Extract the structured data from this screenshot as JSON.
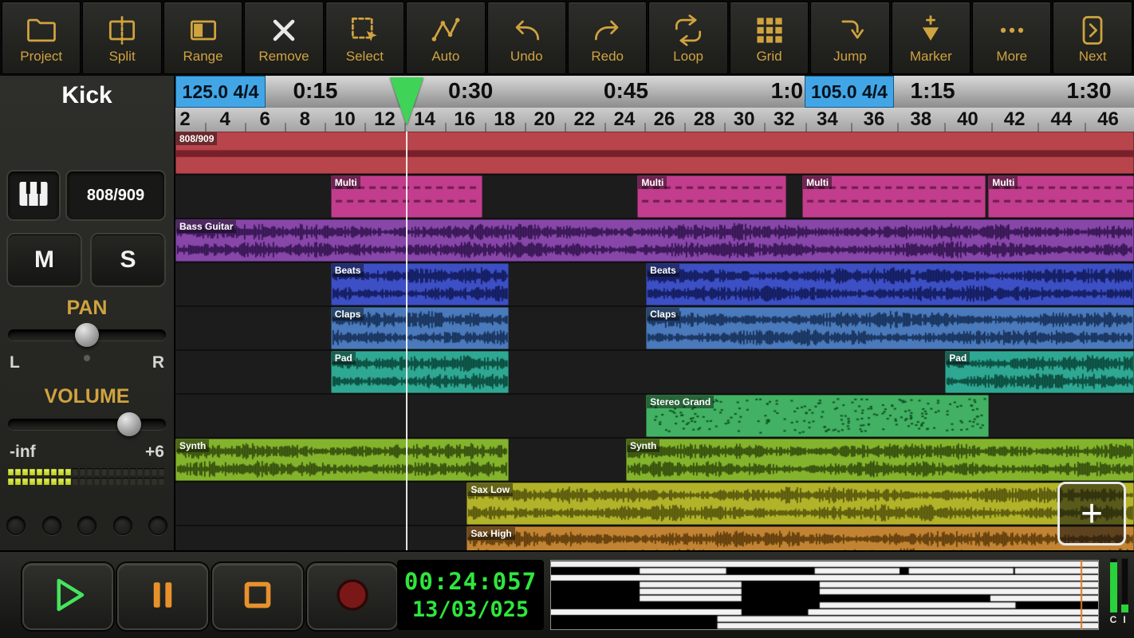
{
  "toolbar": {
    "items": [
      {
        "label": "Project",
        "icon": "folder"
      },
      {
        "label": "Split",
        "icon": "split"
      },
      {
        "label": "Range",
        "icon": "range"
      },
      {
        "label": "Remove",
        "icon": "remove"
      },
      {
        "label": "Select",
        "icon": "select"
      },
      {
        "label": "Auto",
        "icon": "auto"
      },
      {
        "label": "Undo",
        "icon": "undo"
      },
      {
        "label": "Redo",
        "icon": "redo"
      },
      {
        "label": "Loop",
        "icon": "loop"
      },
      {
        "label": "Grid",
        "icon": "grid"
      },
      {
        "label": "Jump",
        "icon": "jump"
      },
      {
        "label": "Marker",
        "icon": "marker"
      },
      {
        "label": "More",
        "icon": "more"
      },
      {
        "label": "Next",
        "icon": "next"
      }
    ],
    "accent_color": "#cfa33f"
  },
  "sidebar": {
    "track_name": "Kick",
    "instrument_label": "808/909",
    "mute": "M",
    "solo": "S",
    "pan": {
      "label": "PAN",
      "left": "L",
      "right": "R",
      "position_pct": 50
    },
    "volume": {
      "label": "VOLUME",
      "min": "-inf",
      "max": "+6",
      "position_pct": 77
    },
    "meter": {
      "rows": 2,
      "segments": 22,
      "lit": 9
    },
    "indicator_count": 5
  },
  "ruler": {
    "tempo_markers": [
      {
        "text": "125.0  4/4",
        "left_pct": 0,
        "width_pct": 9.4
      },
      {
        "text": "105.0  4/4",
        "left_pct": 65.6,
        "width_pct": 9.4
      }
    ],
    "times": [
      {
        "text": "0:15",
        "center_pct": 14.6
      },
      {
        "text": "0:30",
        "center_pct": 30.8
      },
      {
        "text": "0:45",
        "center_pct": 47.0
      },
      {
        "text": "1:0",
        "center_pct": 63.8
      },
      {
        "text": "1:15",
        "center_pct": 79.0
      },
      {
        "text": "1:30",
        "center_pct": 95.3
      }
    ],
    "bars": [
      {
        "n": "2",
        "c": 1.0
      },
      {
        "n": "4",
        "c": 5.17
      },
      {
        "n": "6",
        "c": 9.33
      },
      {
        "n": "8",
        "c": 13.5
      },
      {
        "n": "10",
        "c": 17.67
      },
      {
        "n": "12",
        "c": 21.83
      },
      {
        "n": "14",
        "c": 26.0
      },
      {
        "n": "16",
        "c": 30.17
      },
      {
        "n": "18",
        "c": 34.33
      },
      {
        "n": "20",
        "c": 38.5
      },
      {
        "n": "22",
        "c": 42.67
      },
      {
        "n": "24",
        "c": 46.83
      },
      {
        "n": "26",
        "c": 51.0
      },
      {
        "n": "28",
        "c": 55.17
      },
      {
        "n": "30",
        "c": 59.33
      },
      {
        "n": "32",
        "c": 63.5
      },
      {
        "n": "34",
        "c": 68.0
      },
      {
        "n": "36",
        "c": 72.88
      },
      {
        "n": "38",
        "c": 77.77
      },
      {
        "n": "40",
        "c": 82.65
      },
      {
        "n": "42",
        "c": 87.53
      },
      {
        "n": "44",
        "c": 92.42
      },
      {
        "n": "46",
        "c": 97.3
      }
    ]
  },
  "playhead": {
    "position_pct": 24.1,
    "color": "#3fd457"
  },
  "tracks": [
    {
      "name": "808/909",
      "color": "#b9454c",
      "accent": "#76202a",
      "style": "band",
      "clips": [
        {
          "start_pct": 0,
          "width_pct": 100
        }
      ]
    },
    {
      "name": "Multi",
      "color": "#c23d8d",
      "accent": "#6c1c4c",
      "style": "dash",
      "clips": [
        {
          "start_pct": 16.2,
          "width_pct": 15.8
        },
        {
          "start_pct": 48.2,
          "width_pct": 15.5
        },
        {
          "start_pct": 65.4,
          "width_pct": 19.1
        },
        {
          "start_pct": 84.8,
          "width_pct": 15.2
        }
      ]
    },
    {
      "name": "Bass Guitar",
      "color": "#8746a8",
      "accent": "#2c1048",
      "style": "wave",
      "clips": [
        {
          "start_pct": 0,
          "width_pct": 100
        }
      ]
    },
    {
      "name": "Beats",
      "color": "#3d4fc4",
      "accent": "#0e1650",
      "style": "wave",
      "clips": [
        {
          "start_pct": 16.2,
          "width_pct": 18.6
        },
        {
          "start_pct": 49.1,
          "width_pct": 50.9
        }
      ]
    },
    {
      "name": "Claps",
      "color": "#4a7abc",
      "accent": "#12294e",
      "style": "wave",
      "clips": [
        {
          "start_pct": 16.2,
          "width_pct": 18.6
        },
        {
          "start_pct": 49.1,
          "width_pct": 50.9
        }
      ]
    },
    {
      "name": "Pad",
      "color": "#2fa893",
      "accent": "#073f33",
      "style": "wave",
      "clips": [
        {
          "start_pct": 16.2,
          "width_pct": 18.6
        },
        {
          "start_pct": 80.3,
          "width_pct": 19.7
        }
      ]
    },
    {
      "name": "Stereo Grand",
      "color": "#43b163",
      "accent": "#0d4f24",
      "style": "dots",
      "clips": [
        {
          "start_pct": 49.1,
          "width_pct": 35.8
        }
      ]
    },
    {
      "name": "Synth",
      "color": "#84b42c",
      "accent": "#2c430a",
      "style": "wave",
      "clips": [
        {
          "start_pct": 0,
          "width_pct": 34.8
        },
        {
          "start_pct": 47.0,
          "width_pct": 53.0
        }
      ]
    },
    {
      "name": "Sax Low",
      "color": "#b3b32a",
      "accent": "#4d4d0a",
      "style": "wave",
      "clips": [
        {
          "start_pct": 30.4,
          "width_pct": 69.6
        }
      ]
    },
    {
      "name": "Sax High",
      "color": "#c28433",
      "accent": "#553608",
      "style": "wave",
      "clips": [
        {
          "start_pct": 30.4,
          "width_pct": 69.6
        }
      ]
    }
  ],
  "add_track_label": "+",
  "transport": {
    "buttons": [
      "play",
      "pause",
      "stop",
      "record"
    ],
    "time": "00:24:057",
    "date": "13/03/025",
    "meter_labels": [
      "C",
      "I"
    ],
    "minimap_marker_pct": 96.8
  }
}
